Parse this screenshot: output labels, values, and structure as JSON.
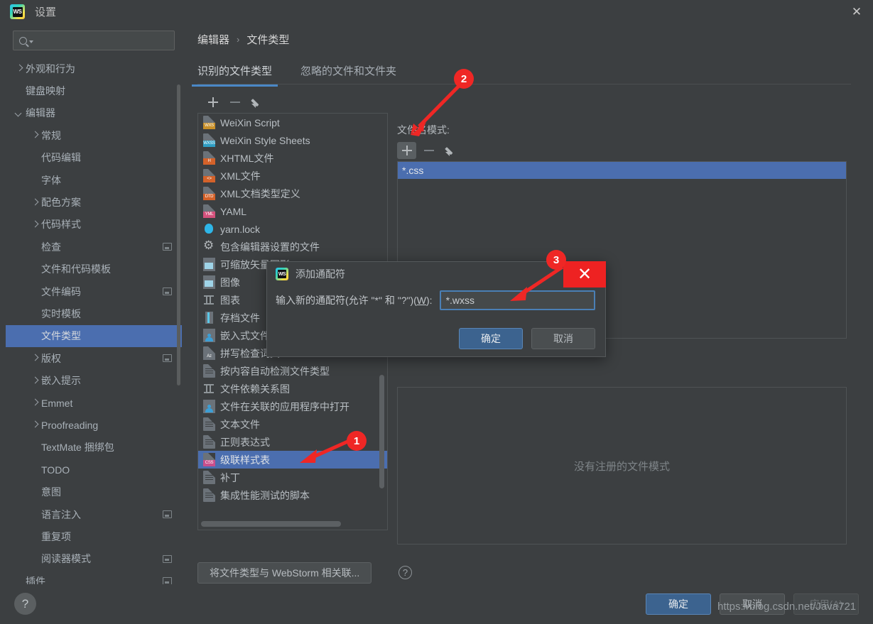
{
  "window": {
    "title": "设置",
    "logo_text": "WS",
    "close_icon": "✕"
  },
  "sidebar": {
    "search": {
      "value": "",
      "placeholder": ""
    },
    "items": [
      {
        "label": "外观和行为",
        "arrow": "closed",
        "indent": 0,
        "badge": false,
        "selected": false
      },
      {
        "label": "键盘映射",
        "arrow": "none",
        "indent": 0,
        "badge": false,
        "selected": false
      },
      {
        "label": "编辑器",
        "arrow": "open",
        "indent": 0,
        "badge": false,
        "selected": false
      },
      {
        "label": "常规",
        "arrow": "closed",
        "indent": 1,
        "badge": false,
        "selected": false
      },
      {
        "label": "代码编辑",
        "arrow": "none",
        "indent": 1,
        "badge": false,
        "selected": false
      },
      {
        "label": "字体",
        "arrow": "none",
        "indent": 1,
        "badge": false,
        "selected": false
      },
      {
        "label": "配色方案",
        "arrow": "closed",
        "indent": 1,
        "badge": false,
        "selected": false
      },
      {
        "label": "代码样式",
        "arrow": "closed",
        "indent": 1,
        "badge": false,
        "selected": false
      },
      {
        "label": "检查",
        "arrow": "none",
        "indent": 1,
        "badge": true,
        "selected": false
      },
      {
        "label": "文件和代码模板",
        "arrow": "none",
        "indent": 1,
        "badge": false,
        "selected": false
      },
      {
        "label": "文件编码",
        "arrow": "none",
        "indent": 1,
        "badge": true,
        "selected": false
      },
      {
        "label": "实时模板",
        "arrow": "none",
        "indent": 1,
        "badge": false,
        "selected": false
      },
      {
        "label": "文件类型",
        "arrow": "none",
        "indent": 1,
        "badge": false,
        "selected": true
      },
      {
        "label": "版权",
        "arrow": "closed",
        "indent": 1,
        "badge": true,
        "selected": false
      },
      {
        "label": "嵌入提示",
        "arrow": "closed",
        "indent": 1,
        "badge": false,
        "selected": false
      },
      {
        "label": "Emmet",
        "arrow": "closed",
        "indent": 1,
        "badge": false,
        "selected": false
      },
      {
        "label": "Proofreading",
        "arrow": "closed",
        "indent": 1,
        "badge": false,
        "selected": false
      },
      {
        "label": "TextMate 捆绑包",
        "arrow": "none",
        "indent": 1,
        "badge": false,
        "selected": false
      },
      {
        "label": "TODO",
        "arrow": "none",
        "indent": 1,
        "badge": false,
        "selected": false
      },
      {
        "label": "意图",
        "arrow": "none",
        "indent": 1,
        "badge": false,
        "selected": false
      },
      {
        "label": "语言注入",
        "arrow": "none",
        "indent": 1,
        "badge": true,
        "selected": false
      },
      {
        "label": "重复项",
        "arrow": "none",
        "indent": 1,
        "badge": false,
        "selected": false
      },
      {
        "label": "阅读器模式",
        "arrow": "none",
        "indent": 1,
        "badge": true,
        "selected": false
      },
      {
        "label": "插件",
        "arrow": "none",
        "indent": 0,
        "badge": true,
        "selected": false
      }
    ]
  },
  "breadcrumb": {
    "parent": "编辑器",
    "separator": "›",
    "current": "文件类型"
  },
  "tabs": [
    {
      "label": "识别的文件类型",
      "active": true
    },
    {
      "label": "忽略的文件和文件夹",
      "active": false
    }
  ],
  "filetype_toolbar": {
    "add": "+",
    "remove": "−",
    "edit": "pencil-icon"
  },
  "filetype_list": [
    {
      "label": "WeiXin Script",
      "icon": "badge",
      "badge": "WXS",
      "badge_color": "#c8902a",
      "selected": false
    },
    {
      "label": "WeiXin Style Sheets",
      "icon": "badge",
      "badge": "WXSS",
      "badge_color": "#2e9ec4",
      "selected": false
    },
    {
      "label": "XHTML文件",
      "icon": "badge",
      "badge": "H",
      "badge_color": "#d4622a",
      "selected": false
    },
    {
      "label": "XML文件",
      "icon": "badge",
      "badge": "<>",
      "badge_color": "#d4622a",
      "selected": false
    },
    {
      "label": "XML文档类型定义",
      "icon": "badge",
      "badge": "DTD",
      "badge_color": "#d4622a",
      "selected": false
    },
    {
      "label": "YAML",
      "icon": "badge",
      "badge": "YML",
      "badge_color": "#d4517c",
      "selected": false
    },
    {
      "label": "yarn.lock",
      "icon": "yarn",
      "badge": "",
      "badge_color": "",
      "selected": false
    },
    {
      "label": "包含编辑器设置的文件",
      "icon": "gear",
      "badge": "",
      "badge_color": "",
      "selected": false
    },
    {
      "label": "可缩放矢量图形",
      "icon": "img",
      "badge": "",
      "badge_color": "",
      "selected": false
    },
    {
      "label": "图像",
      "icon": "img",
      "badge": "",
      "badge_color": "",
      "selected": false
    },
    {
      "label": "图表",
      "icon": "graph",
      "badge": "",
      "badge_color": "",
      "selected": false
    },
    {
      "label": "存档文件",
      "icon": "archive",
      "badge": "",
      "badge_color": "",
      "selected": false
    },
    {
      "label": "嵌入式文件",
      "icon": "person",
      "badge": "",
      "badge_color": "",
      "selected": false
    },
    {
      "label": "拼写检查词典",
      "icon": "badge",
      "badge": "Az",
      "badge_color": "#6b7279",
      "selected": false
    },
    {
      "label": "按内容自动检测文件类型",
      "icon": "doc",
      "badge": "",
      "badge_color": "",
      "selected": false
    },
    {
      "label": "文件依赖关系图",
      "icon": "graph",
      "badge": "",
      "badge_color": "",
      "selected": false
    },
    {
      "label": "文件在关联的应用程序中打开",
      "icon": "person",
      "badge": "",
      "badge_color": "",
      "selected": false
    },
    {
      "label": "文本文件",
      "icon": "doc",
      "badge": "",
      "badge_color": "",
      "selected": false
    },
    {
      "label": "正则表达式",
      "icon": "doc",
      "badge": "",
      "badge_color": "",
      "selected": false
    },
    {
      "label": "级联样式表",
      "icon": "badge",
      "badge": "CSS",
      "badge_color": "#c94f8c",
      "selected": true
    },
    {
      "label": "补丁",
      "icon": "doc",
      "badge": "",
      "badge_color": "",
      "selected": false
    },
    {
      "label": "集成性能测试的脚本",
      "icon": "doc",
      "badge": "",
      "badge_color": "",
      "selected": false
    }
  ],
  "associate_button": {
    "label": "将文件类型与 WebStorm 相关联...",
    "help_icon": "?"
  },
  "pattern_panel": {
    "label": "文件名模式:",
    "toolbar": {
      "add": "+",
      "remove": "−",
      "edit": "pencil-icon"
    },
    "patterns": [
      {
        "value": "*.css",
        "selected": true
      }
    ],
    "empty_message": "没有注册的文件模式"
  },
  "dialog": {
    "logo_text": "WS",
    "title": "添加通配符",
    "prompt_before": "输入新的通配符(允许 \"*\" 和 \"?\")(",
    "prompt_key": "W",
    "prompt_after": "):",
    "input_value": "*.wxss",
    "ok_label": "确定",
    "cancel_label": "取消"
  },
  "bottom_bar": {
    "help_icon": "?",
    "ok_label": "确定",
    "cancel_label": "取消",
    "apply_label": "应用(A)"
  },
  "annotations": [
    {
      "number": "1"
    },
    {
      "number": "2"
    },
    {
      "number": "3"
    }
  ],
  "watermark": "https://blog.csdn.net/Java721",
  "colors": {
    "background": "#3c3f41",
    "selection": "#4b6eaf",
    "accent": "#4a88c7",
    "annotation_red": "#ef2725",
    "primary_button": "#3c638f"
  }
}
